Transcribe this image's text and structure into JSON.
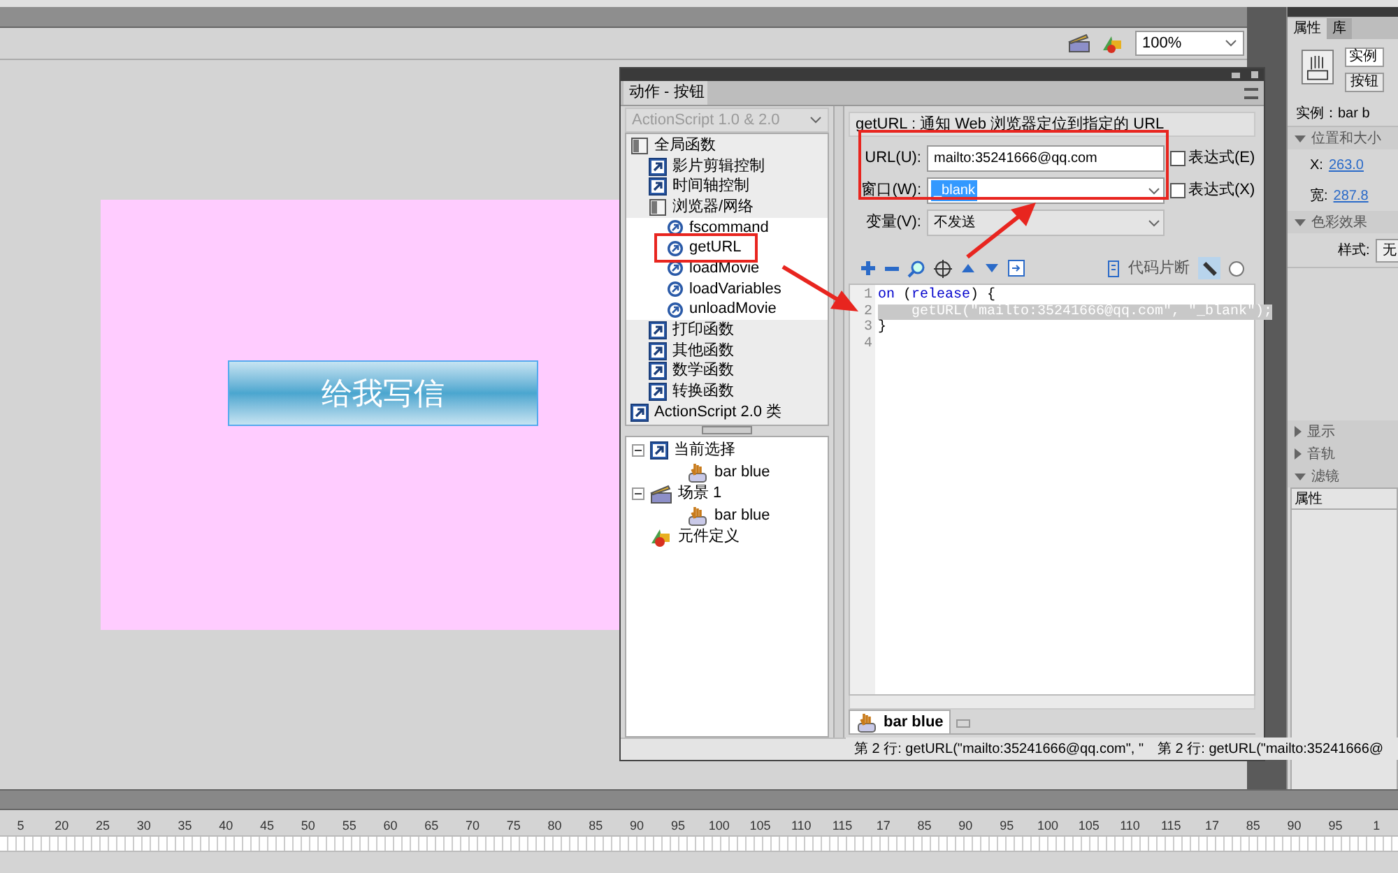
{
  "toolbar": {
    "zoom": "100%"
  },
  "stage": {
    "button_label": "给我写信"
  },
  "actions_panel": {
    "tab": "动作 - 按钮",
    "language": "ActionScript 1.0 & 2.0",
    "toolbox": [
      {
        "label": "全局函数",
        "kind": "book",
        "children": [
          {
            "label": "影片剪辑控制",
            "kind": "category"
          },
          {
            "label": "时间轴控制",
            "kind": "category"
          },
          {
            "label": "浏览器/网络",
            "kind": "book",
            "children": [
              {
                "label": "fscommand",
                "kind": "function"
              },
              {
                "label": "getURL",
                "kind": "function"
              },
              {
                "label": "loadMovie",
                "kind": "function"
              },
              {
                "label": "loadVariables",
                "kind": "function"
              },
              {
                "label": "unloadMovie",
                "kind": "function"
              }
            ]
          },
          {
            "label": "打印函数",
            "kind": "category"
          },
          {
            "label": "其他函数",
            "kind": "category"
          },
          {
            "label": "数学函数",
            "kind": "category"
          },
          {
            "label": "转换函数",
            "kind": "category"
          }
        ]
      },
      {
        "label": "ActionScript 2.0 类",
        "kind": "category"
      }
    ],
    "script_tree": [
      {
        "label": "当前选择",
        "kind": "category",
        "children": [
          {
            "label": "bar blue",
            "kind": "symbol"
          }
        ]
      },
      {
        "label": "场景 1",
        "kind": "scene",
        "children": [
          {
            "label": "bar blue",
            "kind": "symbol"
          }
        ]
      },
      {
        "label": "元件定义",
        "kind": "shapes"
      }
    ],
    "description": "getURL : 通知 Web 浏览器定位到指定的 URL",
    "params": [
      {
        "label": "URL(U):",
        "kind": "text",
        "value": "mailto:35241666@qq.com",
        "value_selected": false,
        "expression": {
          "label": "表达式(E)",
          "checked": false
        }
      },
      {
        "label": "窗口(W):",
        "kind": "select",
        "value": "_blank",
        "value_selected": true,
        "expression": {
          "label": "表达式(X)",
          "checked": false
        }
      },
      {
        "label": "变量(V):",
        "kind": "select",
        "value": "不发送",
        "value_selected": false
      }
    ],
    "snippets": "代码片断",
    "code": [
      {
        "number": "1",
        "selected": false,
        "tokens": [
          {
            "text": "on",
            "kind": "keyword"
          },
          {
            "text": " (",
            "kind": "plain"
          },
          {
            "text": "release",
            "kind": "keyword"
          },
          {
            "text": ") {",
            "kind": "plain"
          }
        ]
      },
      {
        "number": "2",
        "selected": true,
        "tokens": [
          {
            "text": "    getURL(\"mailto:35241666@qq.com\", \"_blank\");",
            "kind": "plain"
          }
        ]
      },
      {
        "number": "3",
        "selected": false,
        "tokens": [
          {
            "text": "}",
            "kind": "plain"
          }
        ]
      },
      {
        "number": "4",
        "selected": false
      }
    ],
    "script_tab": "bar blue",
    "status": [
      "第 2 行: getURL(\"mailto:35241666@qq.com\", \"",
      "第 2 行: getURL(\"mailto:35241666@"
    ]
  },
  "properties": {
    "tabs": [
      {
        "label": "属性",
        "selected": true
      },
      {
        "label": "库",
        "selected": false
      }
    ],
    "instance_field": "实例",
    "type_button": "按钮",
    "instance": "实例：bar b",
    "rows": [
      {
        "kind": "section",
        "label": "位置和大小",
        "expanded": true
      },
      {
        "kind": "field",
        "label": "X:",
        "value": "263.0"
      },
      {
        "kind": "field",
        "label": "宽:",
        "value": "287.8"
      },
      {
        "kind": "section",
        "label": "色彩效果",
        "expanded": true
      },
      {
        "kind": "select",
        "label": "样式:",
        "value": "无"
      },
      {
        "kind": "gap"
      },
      {
        "kind": "section",
        "label": "显示",
        "expanded": false
      },
      {
        "kind": "section",
        "label": "音轨",
        "expanded": false
      },
      {
        "kind": "section",
        "label": "滤镜",
        "expanded": true
      },
      {
        "kind": "header",
        "label": "属性"
      }
    ]
  },
  "timeline": {
    "ruler": [
      "5",
      "20",
      "25",
      "30",
      "35",
      "40",
      "45",
      "50",
      "55",
      "60",
      "65",
      "70",
      "75",
      "80",
      "85",
      "90",
      "95",
      "100",
      "105",
      "110",
      "115",
      "17",
      "85",
      "90",
      "95",
      "100",
      "105",
      "110",
      "115",
      "17",
      "85",
      "90",
      "95",
      "1"
    ]
  }
}
